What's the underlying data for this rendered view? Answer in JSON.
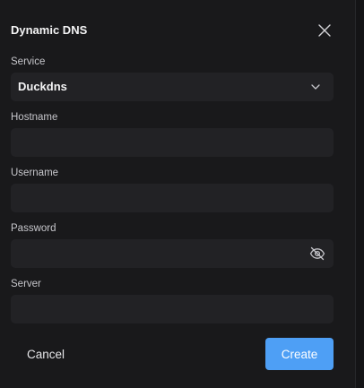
{
  "dialog": {
    "title": "Dynamic DNS",
    "close_icon": "close-icon"
  },
  "fields": {
    "service": {
      "label": "Service",
      "selected": "Duckdns",
      "icon": "chevron-down-icon"
    },
    "hostname": {
      "label": "Hostname",
      "value": "",
      "placeholder": ""
    },
    "username": {
      "label": "Username",
      "value": "",
      "placeholder": ""
    },
    "password": {
      "label": "Password",
      "value": "",
      "placeholder": "",
      "icon": "eye-off-icon"
    },
    "server": {
      "label": "Server",
      "value": "",
      "placeholder": ""
    }
  },
  "actions": {
    "cancel_label": "Cancel",
    "create_label": "Create"
  },
  "colors": {
    "background": "#19191b",
    "input_background": "#222225",
    "primary": "#4e9ff5",
    "text": "#f4f4f5",
    "label": "#c6c6cb"
  }
}
